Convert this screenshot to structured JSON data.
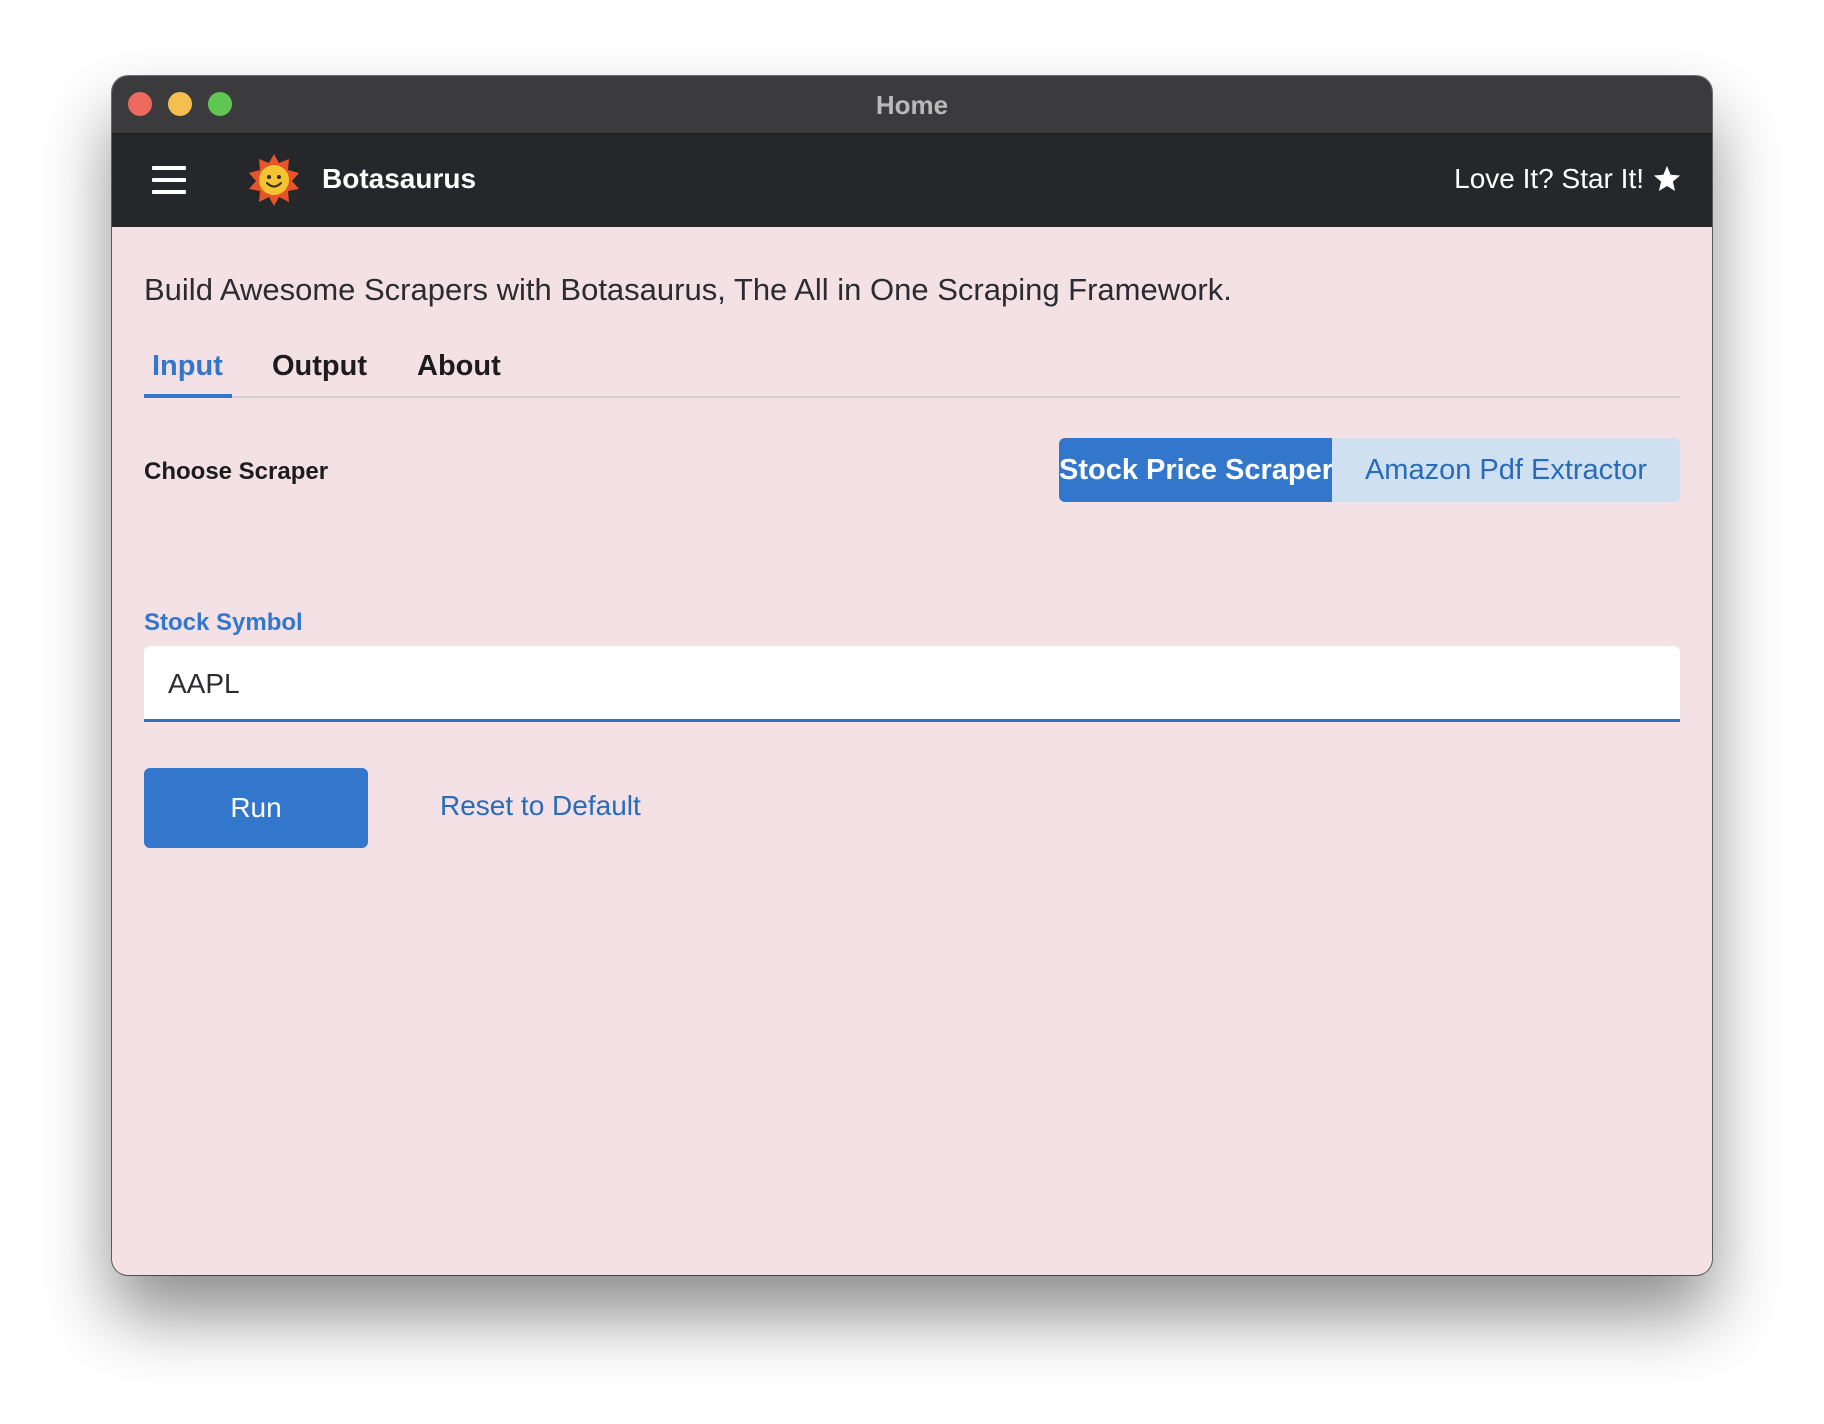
{
  "window": {
    "title": "Home"
  },
  "appbar": {
    "brand": "Botasaurus",
    "star_link": "Love It? Star It!"
  },
  "page": {
    "tagline": "Build Awesome Scrapers with Botasaurus, The All in One Scraping Framework."
  },
  "tabs": [
    {
      "label": "Input",
      "active": true
    },
    {
      "label": "Output",
      "active": false
    },
    {
      "label": "About",
      "active": false
    }
  ],
  "scraper_choice": {
    "label": "Choose Scraper",
    "options": [
      "Stock Price Scraper",
      "Amazon Pdf Extractor"
    ],
    "selected": "Stock Price Scraper"
  },
  "form": {
    "stock_symbol_label": "Stock Symbol",
    "stock_symbol_value": "AAPL"
  },
  "actions": {
    "run_label": "Run",
    "reset_label": "Reset to Default"
  },
  "colors": {
    "accent": "#3377cc",
    "background": "#f3e1e6",
    "appbar": "#25272b",
    "titlebar": "#3b3b3d"
  },
  "icons": {
    "menu": "hamburger-menu-icon",
    "logo": "sun-smiley-logo",
    "star": "star-icon"
  }
}
